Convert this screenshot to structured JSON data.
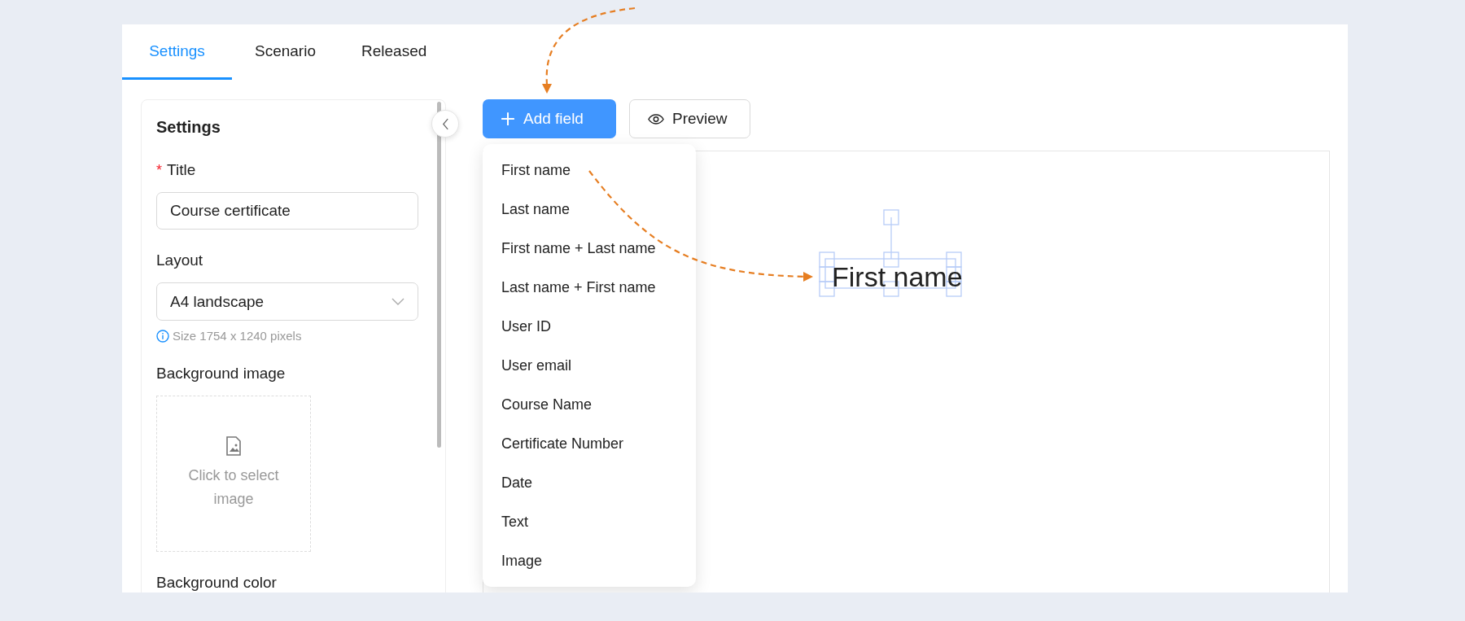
{
  "tabs": [
    {
      "label": "Settings",
      "selected": true
    },
    {
      "label": "Scenario",
      "selected": false
    },
    {
      "label": "Released",
      "selected": false
    }
  ],
  "settings": {
    "title": "Settings",
    "title_field": {
      "required_mark": "*",
      "label": "Title",
      "value": "Course certificate"
    },
    "layout_field": {
      "label": "Layout",
      "value": "A4 landscape",
      "hint": "Size 1754 x 1240 pixels"
    },
    "background_image": {
      "label": "Background image",
      "placeholder": "Click to select image"
    },
    "background_color": {
      "label": "Background color"
    }
  },
  "toolbar": {
    "add_field": "Add field",
    "preview": "Preview"
  },
  "field_menu": [
    "First name",
    "Last name",
    "First name + Last name",
    "Last name + First name",
    "User ID",
    "User email",
    "Course Name",
    "Certificate Number",
    "Date",
    "Text",
    "Image"
  ],
  "canvas": {
    "element": {
      "text": "First name",
      "selected": true
    }
  }
}
